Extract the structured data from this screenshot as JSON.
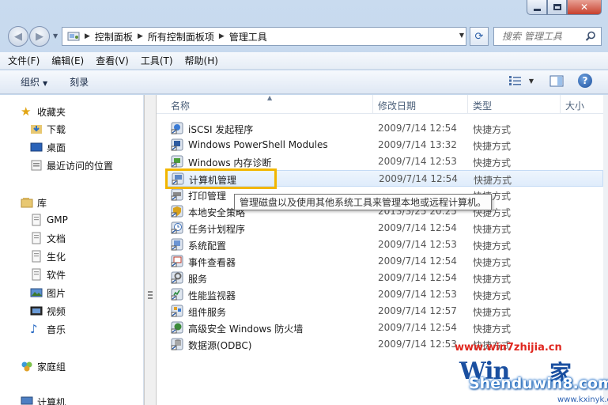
{
  "address": {
    "crumbs": [
      "控制面板",
      "所有控制面板项",
      "管理工具"
    ]
  },
  "search": {
    "placeholder": "搜索 管理工具"
  },
  "menu": [
    "文件(F)",
    "编辑(E)",
    "查看(V)",
    "工具(T)",
    "帮助(H)"
  ],
  "toolbar": {
    "organize": "组织",
    "burn": "刻录"
  },
  "nav": {
    "favorites": "收藏夹",
    "downloads": "下载",
    "desktop": "桌面",
    "recent": "最近访问的位置",
    "libraries": "库",
    "gmp": "GMP",
    "documents": "文档",
    "shenghua": "生化",
    "software": "软件",
    "pictures": "图片",
    "videos": "视频",
    "music": "音乐",
    "homegroup": "家庭组",
    "computer": "计算机"
  },
  "columns": {
    "name": "名称",
    "date": "修改日期",
    "type": "类型",
    "size": "大小"
  },
  "files": [
    {
      "name": "iSCSI 发起程序",
      "date": "2009/7/14 12:54",
      "type": "快捷方式"
    },
    {
      "name": "Windows PowerShell Modules",
      "date": "2009/7/14 13:32",
      "type": "快捷方式"
    },
    {
      "name": "Windows 内存诊断",
      "date": "2009/7/14 12:53",
      "type": "快捷方式"
    },
    {
      "name": "计算机管理",
      "date": "2009/7/14 12:54",
      "type": "快捷方式"
    },
    {
      "name": "打印管理",
      "date": "",
      "type": "快捷方式"
    },
    {
      "name": "本地安全策略",
      "date": "2013/3/25 20:25",
      "type": "快捷方式"
    },
    {
      "name": "任务计划程序",
      "date": "2009/7/14 12:54",
      "type": "快捷方式"
    },
    {
      "name": "系统配置",
      "date": "2009/7/14 12:53",
      "type": "快捷方式"
    },
    {
      "name": "事件查看器",
      "date": "2009/7/14 12:54",
      "type": "快捷方式"
    },
    {
      "name": "服务",
      "date": "2009/7/14 12:54",
      "type": "快捷方式"
    },
    {
      "name": "性能监视器",
      "date": "2009/7/14 12:53",
      "type": "快捷方式"
    },
    {
      "name": "组件服务",
      "date": "2009/7/14 12:57",
      "type": "快捷方式"
    },
    {
      "name": "高级安全 Windows 防火墙",
      "date": "2009/7/14 12:54",
      "type": "快捷方式"
    },
    {
      "name": "数据源(ODBC)",
      "date": "2009/7/14 12:53",
      "type": "快捷方式"
    }
  ],
  "tooltip": "管理磁盘以及使用其他系统工具来管理本地或远程计算机。",
  "watermark": {
    "url": "www.win7zhijia.cn",
    "win": "Win",
    "jia": "家",
    "site": "Shenduwin8.com",
    "sub": "www.kxinyk.com"
  },
  "colors": {
    "highlight": "#f2b600",
    "selection": "#dfecfb",
    "accent": "#1a4fa0"
  }
}
